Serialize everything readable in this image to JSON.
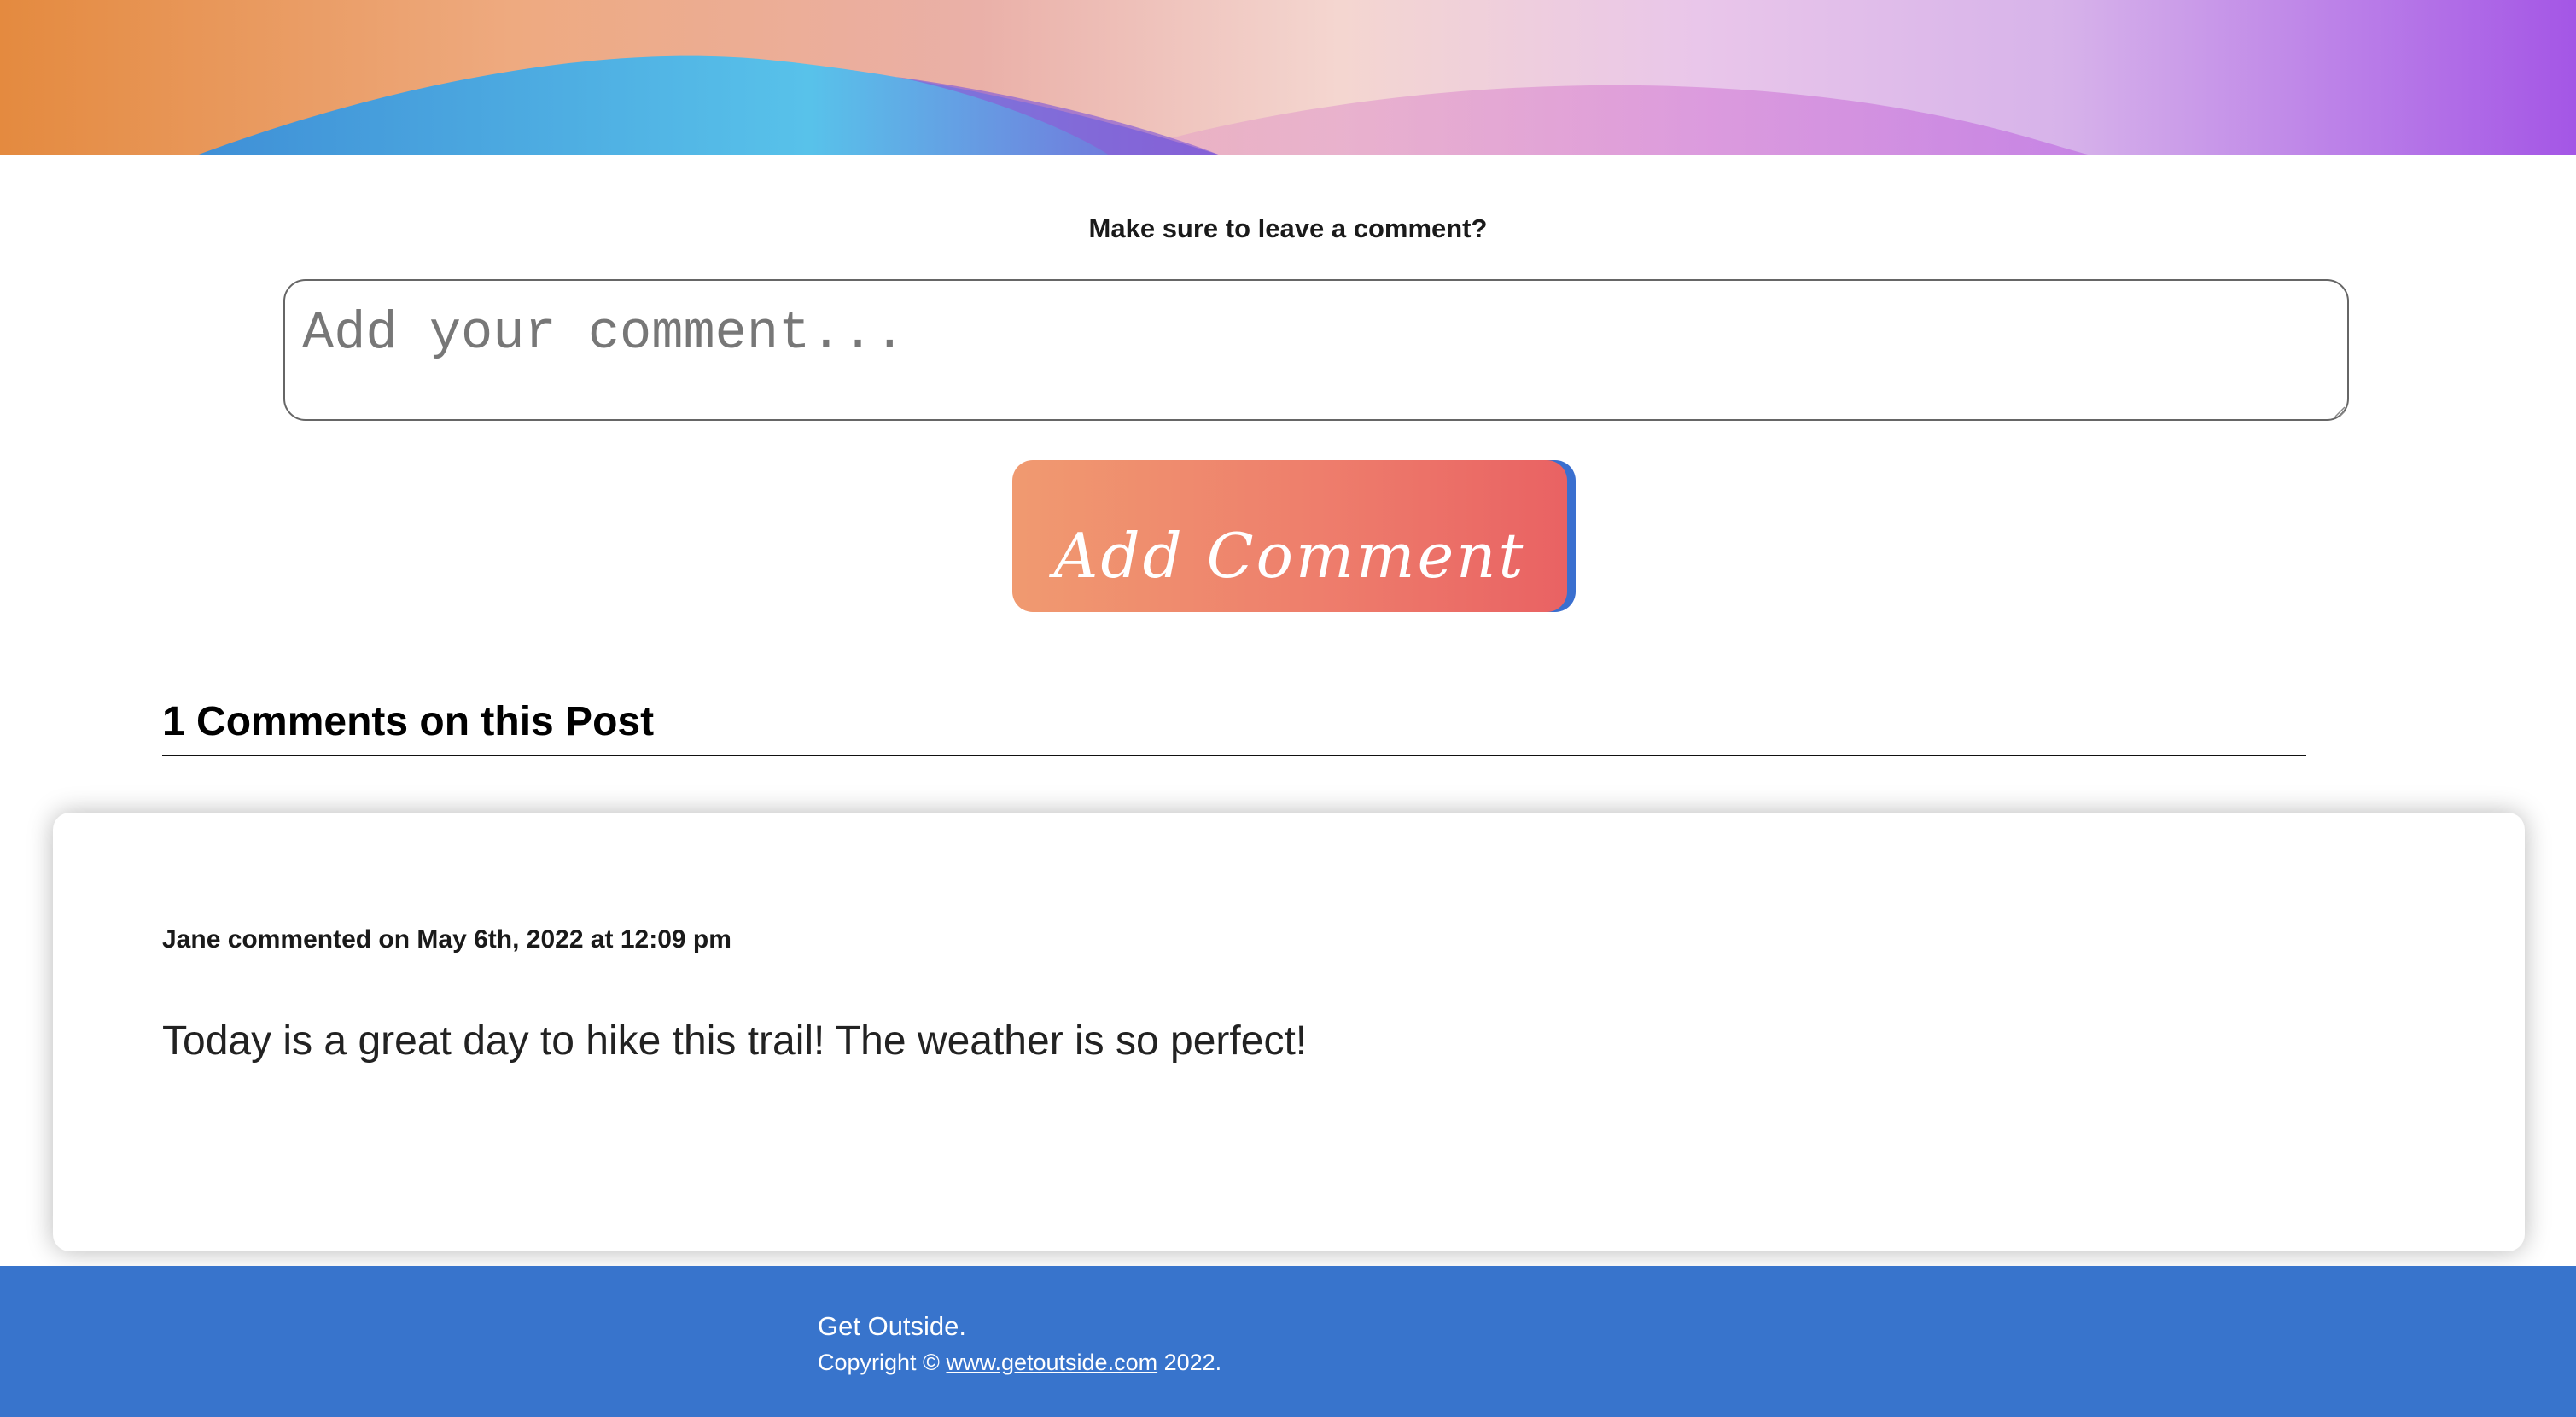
{
  "banner": {
    "colors": {
      "orange": "#e48a3f",
      "peach": "#eeaa80",
      "pink": "#eab0a8",
      "lavender": "#d7b3ea",
      "purple": "#a456e6",
      "blue_wave": "#4ea6e0"
    }
  },
  "comment_form": {
    "prompt": "Make sure to leave a comment?",
    "input_placeholder": "Add your comment...",
    "input_value": "",
    "submit_label": "Add Comment",
    "submit_colors": {
      "gradient_start": "#f09a70",
      "gradient_end": "#e96263",
      "shadow": "#3a6fcf"
    }
  },
  "comments_section": {
    "heading": "1 Comments on this Post",
    "comments": [
      {
        "meta": "Jane commented on May 6th, 2022 at 12:09 pm",
        "body": "Today is a great day to hike this trail! The weather is so perfect!"
      }
    ]
  },
  "footer": {
    "brand": "Get Outside.",
    "copyright_prefix": "Copyright ©",
    "link_text": "www.getoutside.com",
    "copyright_suffix": "2022.",
    "background": "#3874cc"
  }
}
